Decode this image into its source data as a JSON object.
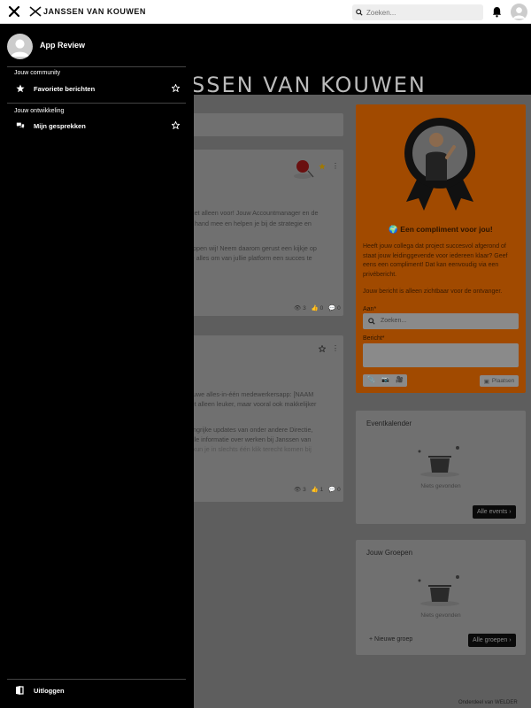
{
  "header": {
    "logo_text": "JANSSEN VAN KOUWEN",
    "search_placeholder": "Zoeken..."
  },
  "hero": {
    "title_visible": "SSEN VAN KOUWEN"
  },
  "drawer": {
    "profile_name": "App Review",
    "sections": [
      {
        "label": "Jouw community",
        "items": [
          {
            "label": "Favoriete berichten",
            "icon": "star-icon"
          }
        ]
      },
      {
        "label": "Jouw ontwikkeling",
        "items": [
          {
            "label": "Mijn gesprekken",
            "icon": "chat-icon"
          }
        ]
      }
    ],
    "logout_label": "Uitloggen"
  },
  "feed": {
    "post1_lines": [
      "niet alleen voor! Jouw Accountmanager en de",
      "e hand mee en helpen je bij de strategie en",
      "",
      "eppen wij! Neem daarom gerust een kijkje op",
      "je alles om van jullie platform een succes te"
    ],
    "post1_stats": {
      "views": "3",
      "likes": "0",
      "comments": "0"
    },
    "post2_lines": [
      "euwe alles-in-één medewerkersapp: [NAAM",
      "iet alleen leuker, maar vooral ook makkelijker",
      "",
      "angrijke updates van onder andere Directie,",
      "alle informatie over werken bij Janssen van",
      "i kun je in slechts één klik terecht komen bij"
    ],
    "post2_stats": {
      "views": "3",
      "likes": "1",
      "comments": "0"
    }
  },
  "compliment": {
    "title": "Een compliment voor jou!",
    "text": "Heeft jouw collega dat project succesvol afgerond of staat jouw leidinggevende voor iedereen klaar? Geef eens een compliment! Dat kan eenvoudig via een privébericht.",
    "visibility_note": "Jouw bericht is alleen zichtbaar voor de ontvanger.",
    "to_label": "Aan*",
    "to_placeholder": "Zoeken...",
    "message_label": "Bericht*",
    "post_button": "Plaatsen"
  },
  "events": {
    "title": "Eventkalender",
    "empty_text": "Niets gevonden",
    "all_button": "Alle events"
  },
  "groups": {
    "title": "Jouw Groepen",
    "empty_text": "Niets gevonden",
    "new_group": "Nieuwe groep",
    "all_button": "Alle groepen"
  },
  "footer": {
    "note": "Onderdeel van WELDER"
  },
  "colors": {
    "drawer_bg": "#000000",
    "accent_orange": "#a14a00"
  }
}
